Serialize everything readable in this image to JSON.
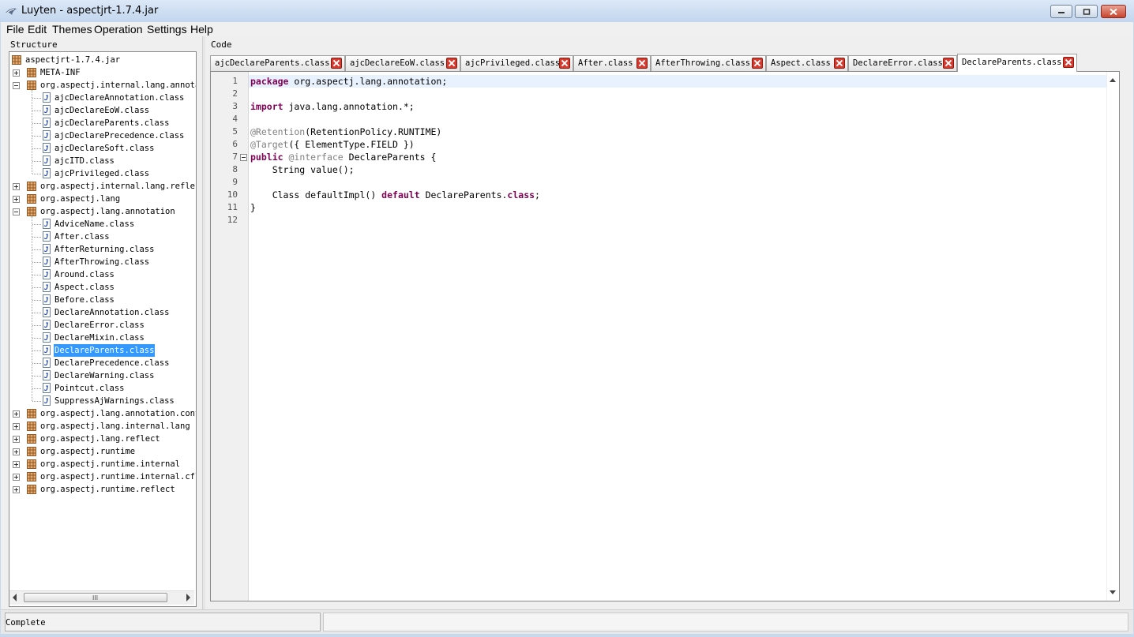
{
  "window": {
    "title": "Luyten - aspectjrt-1.7.4.jar",
    "controls": [
      "minimize",
      "maximize",
      "close"
    ]
  },
  "menu": [
    "File",
    "Edit",
    "Themes",
    "Operation",
    "Settings",
    "Help"
  ],
  "structure": {
    "label": "Structure",
    "tree": [
      {
        "label": "aspectjrt-1.7.4.jar",
        "type": "jar",
        "level": 0
      },
      {
        "label": "META-INF",
        "type": "package",
        "level": 1,
        "expander": "plus"
      },
      {
        "label": "org.aspectj.internal.lang.annotat",
        "type": "package",
        "level": 1,
        "expander": "minus"
      },
      {
        "label": "ajcDeclareAnnotation.class",
        "type": "class",
        "level": 2
      },
      {
        "label": "ajcDeclareEoW.class",
        "type": "class",
        "level": 2
      },
      {
        "label": "ajcDeclareParents.class",
        "type": "class",
        "level": 2
      },
      {
        "label": "ajcDeclarePrecedence.class",
        "type": "class",
        "level": 2
      },
      {
        "label": "ajcDeclareSoft.class",
        "type": "class",
        "level": 2
      },
      {
        "label": "ajcITD.class",
        "type": "class",
        "level": 2
      },
      {
        "label": "ajcPrivileged.class",
        "type": "class",
        "level": 2
      },
      {
        "label": "org.aspectj.internal.lang.reflect",
        "type": "package",
        "level": 1,
        "expander": "plus"
      },
      {
        "label": "org.aspectj.lang",
        "type": "package",
        "level": 1,
        "expander": "plus"
      },
      {
        "label": "org.aspectj.lang.annotation",
        "type": "package",
        "level": 1,
        "expander": "minus"
      },
      {
        "label": "AdviceName.class",
        "type": "class",
        "level": 2
      },
      {
        "label": "After.class",
        "type": "class",
        "level": 2
      },
      {
        "label": "AfterReturning.class",
        "type": "class",
        "level": 2
      },
      {
        "label": "AfterThrowing.class",
        "type": "class",
        "level": 2
      },
      {
        "label": "Around.class",
        "type": "class",
        "level": 2
      },
      {
        "label": "Aspect.class",
        "type": "class",
        "level": 2
      },
      {
        "label": "Before.class",
        "type": "class",
        "level": 2
      },
      {
        "label": "DeclareAnnotation.class",
        "type": "class",
        "level": 2
      },
      {
        "label": "DeclareError.class",
        "type": "class",
        "level": 2
      },
      {
        "label": "DeclareMixin.class",
        "type": "class",
        "level": 2
      },
      {
        "label": "DeclareParents.class",
        "type": "class",
        "level": 2,
        "selected": true
      },
      {
        "label": "DeclarePrecedence.class",
        "type": "class",
        "level": 2
      },
      {
        "label": "DeclareWarning.class",
        "type": "class",
        "level": 2
      },
      {
        "label": "Pointcut.class",
        "type": "class",
        "level": 2
      },
      {
        "label": "SuppressAjWarnings.class",
        "type": "class",
        "level": 2
      },
      {
        "label": "org.aspectj.lang.annotation.contr",
        "type": "package",
        "level": 1,
        "expander": "plus"
      },
      {
        "label": "org.aspectj.lang.internal.lang",
        "type": "package",
        "level": 1,
        "expander": "plus"
      },
      {
        "label": "org.aspectj.lang.reflect",
        "type": "package",
        "level": 1,
        "expander": "plus"
      },
      {
        "label": "org.aspectj.runtime",
        "type": "package",
        "level": 1,
        "expander": "plus"
      },
      {
        "label": "org.aspectj.runtime.internal",
        "type": "package",
        "level": 1,
        "expander": "plus"
      },
      {
        "label": "org.aspectj.runtime.internal.cflo",
        "type": "package",
        "level": 1,
        "expander": "plus"
      },
      {
        "label": "org.aspectj.runtime.reflect",
        "type": "package",
        "level": 1,
        "expander": "plus"
      }
    ]
  },
  "code": {
    "label": "Code",
    "tabs": [
      {
        "label": "ajcDeclareParents.class"
      },
      {
        "label": "ajcDeclareEoW.class"
      },
      {
        "label": "ajcPrivileged.class"
      },
      {
        "label": "After.class"
      },
      {
        "label": "AfterThrowing.class"
      },
      {
        "label": "Aspect.class"
      },
      {
        "label": "DeclareError.class"
      },
      {
        "label": "DeclareParents.class",
        "active": true
      }
    ],
    "lines": [
      [
        {
          "t": "package",
          "c": "kw"
        },
        {
          "t": " org.aspectj.lang.annotation;"
        }
      ],
      [],
      [
        {
          "t": "import",
          "c": "kw"
        },
        {
          "t": " java.lang.annotation.*;"
        }
      ],
      [],
      [
        {
          "t": "@Retention",
          "c": "ann"
        },
        {
          "t": "(RetentionPolicy.RUNTIME)"
        }
      ],
      [
        {
          "t": "@Target",
          "c": "ann"
        },
        {
          "t": "({ ElementType.FIELD })"
        }
      ],
      [
        {
          "t": "public",
          "c": "kw"
        },
        {
          "t": " "
        },
        {
          "t": "@interface",
          "c": "ann"
        },
        {
          "t": " DeclareParents {"
        }
      ],
      [
        {
          "t": "    String value();"
        }
      ],
      [],
      [
        {
          "t": "    Class defaultImpl() "
        },
        {
          "t": "default",
          "c": "kw"
        },
        {
          "t": " DeclareParents."
        },
        {
          "t": "class",
          "c": "kw"
        },
        {
          "t": ";"
        }
      ],
      [
        {
          "t": "}"
        }
      ],
      []
    ],
    "fold_line": 7
  },
  "status": {
    "text": "Complete"
  },
  "colors": {
    "keyword": "#7f0055",
    "annotation": "#808080",
    "selection": "#3399ff",
    "current_line": "#e8f2fe"
  }
}
